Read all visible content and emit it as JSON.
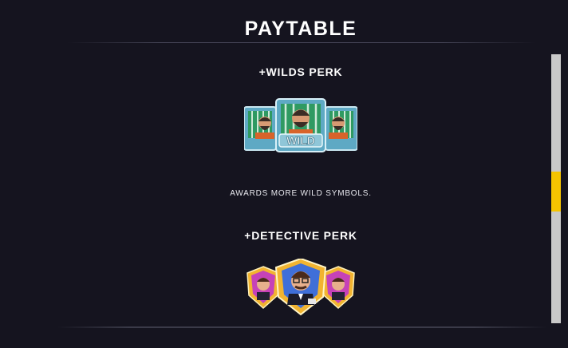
{
  "header": {
    "title": "PAYTABLE"
  },
  "perks": [
    {
      "heading": "+WILDS PERK",
      "description": "AWARDS MORE WILD SYMBOLS.",
      "symbol_icon": "wild-symbol-icon",
      "symbol_text": "WILD"
    },
    {
      "heading": "+DETECTIVE PERK",
      "description": "",
      "symbol_icon": "detective-symbol-icon"
    }
  ],
  "scrollbar": {
    "position_fraction": 0.48
  },
  "colors": {
    "background": "#15141f",
    "scroll_thumb": "#f5c400",
    "scroll_track": "#c9c9c9",
    "wild_cell": "#5ea9c4",
    "wild_bars": "#2f9a62",
    "detective_badge": "#f2b430",
    "detective_badge_inner": "#c642b8"
  }
}
